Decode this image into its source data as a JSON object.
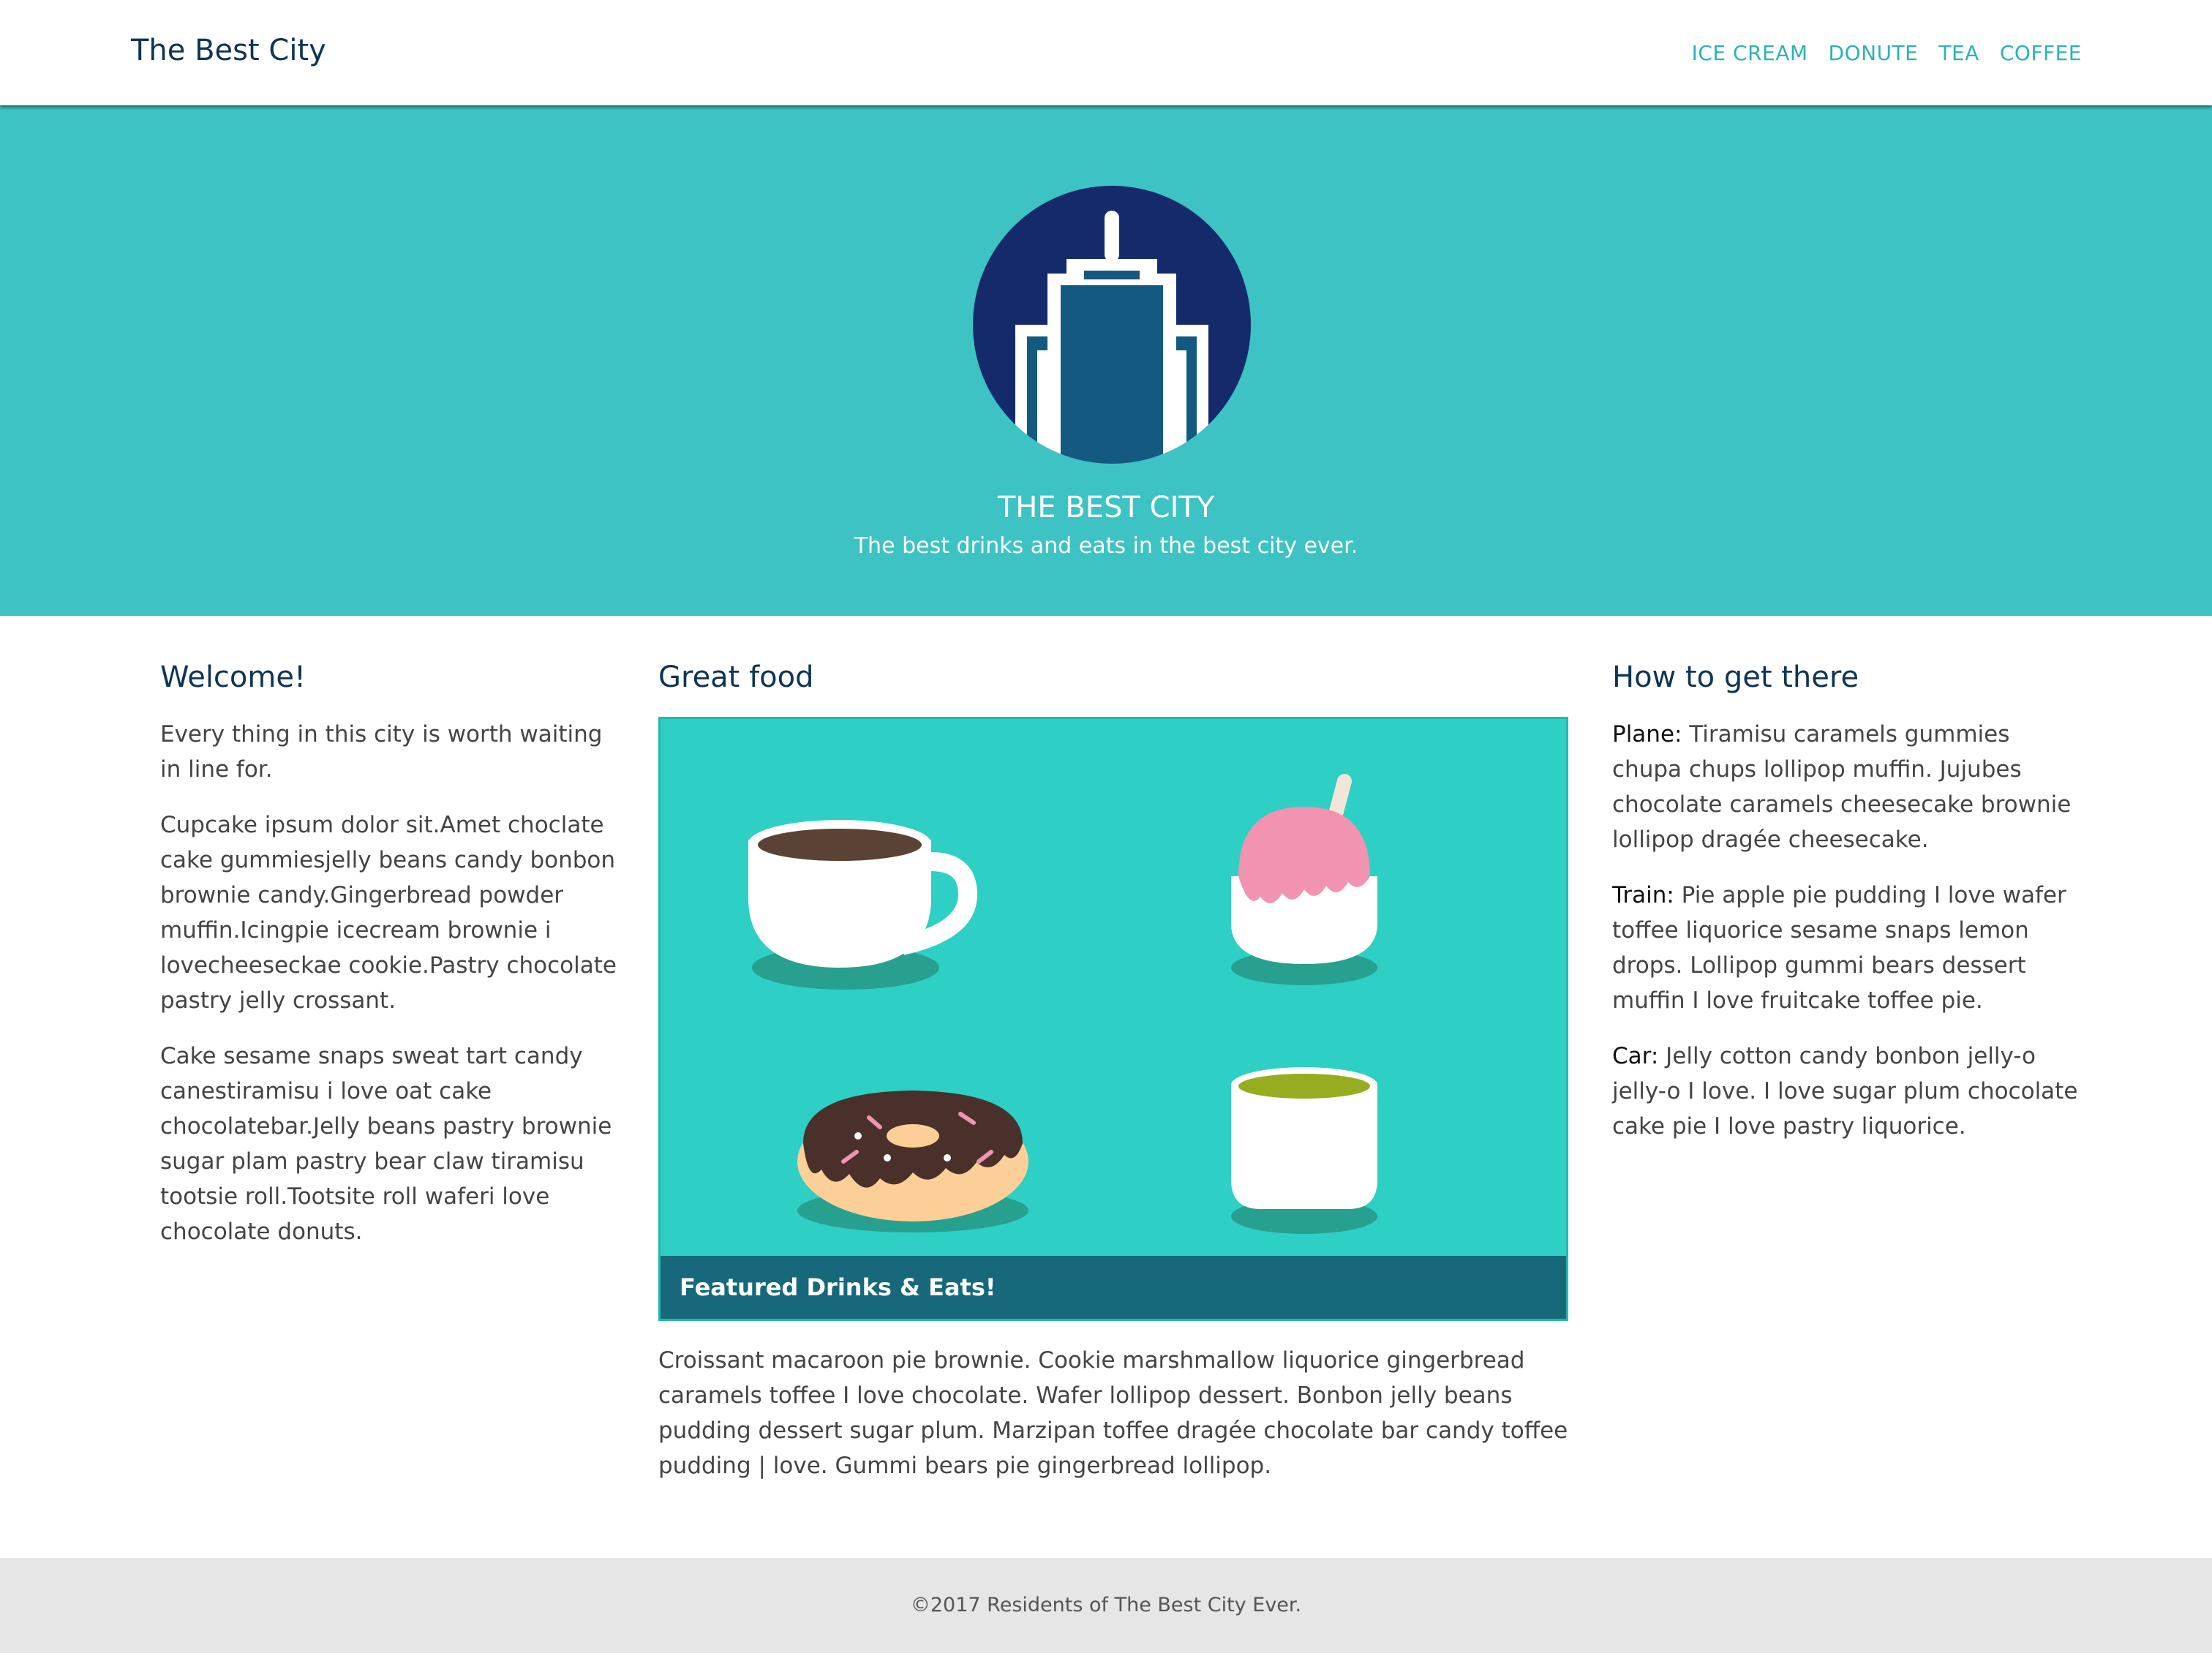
{
  "header": {
    "brand": "The Best City",
    "nav": [
      "ICE CREAM",
      "DONUTE",
      "TEA",
      "COFFEE"
    ]
  },
  "hero": {
    "title": "THE BEST CITY",
    "subtitle": "The best drinks and eats in the best city ever."
  },
  "left": {
    "heading": "Welcome!",
    "paragraphs": [
      "Every thing in this city is worth waiting in line for.",
      "Cupcake ipsum dolor sit.Amet choclate cake gummiesjelly beans candy bonbon brownie candy.Gingerbread powder muffin.Icingpie icecream brownie i lovecheeseckae cookie.Pastry chocolate pastry jelly crossant.",
      "Cake sesame snaps sweat tart candy canestiramisu i love oat cake chocolatebar.Jelly beans pastry brownie sugar plam pastry bear claw tiramisu tootsie roll.Tootsite roll waferi love chocolate donuts."
    ]
  },
  "middle": {
    "heading": "Great food",
    "caption": "Featured Drinks & Eats!",
    "paragraph": "Croissant macaroon pie brownie. Cookie marshmallow liquorice gingerbread caramels toffee I love chocolate. Wafer lollipop dessert. Bonbon jelly beans pudding dessert sugar plum. Marzipan toffee dragée chocolate bar candy toffee pudding | love. Gummi bears pie gingerbread lollipop."
  },
  "right": {
    "heading": "How to get there",
    "items": [
      {
        "label": "Plane:",
        "text": " Tiramisu caramels gummies chupa chups lollipop muffin. Jujubes chocolate caramels cheesecake brownie lollipop dragée cheesecake."
      },
      {
        "label": "Train:",
        "text": " Pie apple pie pudding I love wafer toffee liquorice sesame snaps lemon drops. Lollipop gummi bears dessert muffin I love fruitcake toffee pie."
      },
      {
        "label": "Car:",
        "text": " Jelly cotton candy bonbon jelly-o jelly-o I love. I love sugar plum chocolate cake pie I love pastry liquorice."
      }
    ]
  },
  "footer": {
    "text": "©2017 Residents of The Best City Ever."
  },
  "colors": {
    "teal": "#3dc3c4",
    "navy": "#0f3455",
    "link": "#2bb3b5",
    "caption_bg": "#17687a"
  }
}
